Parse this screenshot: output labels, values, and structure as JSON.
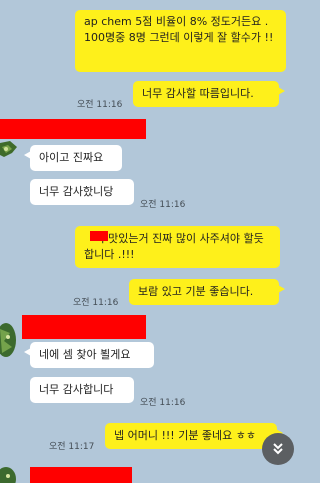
{
  "chat": {
    "messages": [
      {
        "id": "m1",
        "from": "me",
        "text": "ap chem 5점 비율이 8% 정도거든요 . 100명중 8명 그런데 이렇게 잘 할수가 !!"
      },
      {
        "id": "m2",
        "from": "me",
        "text": "너무 감사할 따름입니다.",
        "time": "오전 11:16"
      },
      {
        "id": "m3",
        "from": "other",
        "text": "아이고 진짜요"
      },
      {
        "id": "m4",
        "from": "other",
        "text": "너무 감사핬니당",
        "time": "오전 11:16"
      },
      {
        "id": "m5",
        "from": "me",
        "text": "   이 맛있는거 진짜 많이 사주셔야 할듯 합니다 .!!!"
      },
      {
        "id": "m6",
        "from": "me",
        "text": "보람 있고 기분 좋습니다.",
        "time": "오전 11:16"
      },
      {
        "id": "m7",
        "from": "other",
        "text": "네에 셈 찾아 뵐게요"
      },
      {
        "id": "m8",
        "from": "other",
        "text": "너무 감사합니다",
        "time": "오전 11:16"
      },
      {
        "id": "m9",
        "from": "me",
        "text": "넵 어머니 !!! 기분 좋네요 ㅎㅎ",
        "time": "오전 11:17"
      }
    ]
  },
  "controls": {
    "scroll_down_icon": "chevron-double-down-icon"
  },
  "colors": {
    "background": "#b2c7d9",
    "my_bubble": "#fef01b",
    "their_bubble": "#ffffff",
    "redaction": "#ff0000"
  }
}
